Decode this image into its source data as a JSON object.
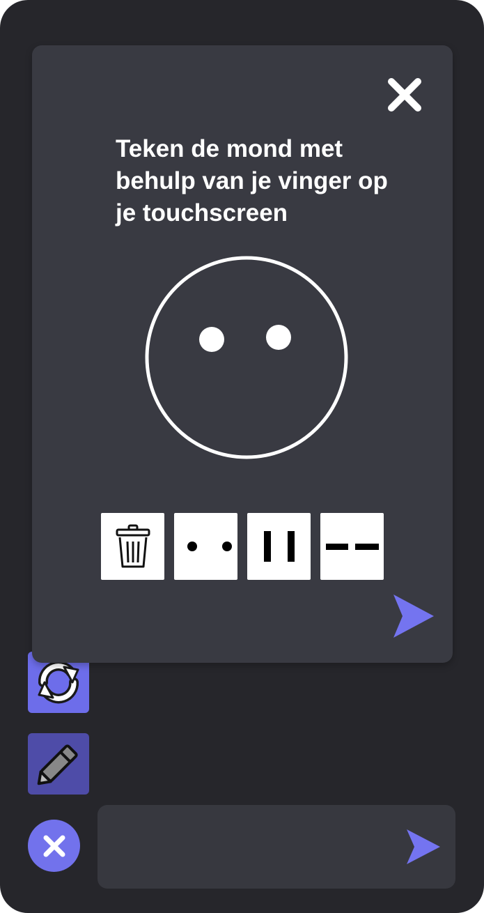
{
  "modal": {
    "instruction": "Teken de mond met behulp van je vinger op je touchscreen",
    "close_icon": "close-icon",
    "face_icon": "face-outline-icon",
    "mouth_options": [
      {
        "name": "delete-drawing-button",
        "icon": "trash-icon"
      },
      {
        "name": "mouth-option-dots",
        "icon": "dots-icon"
      },
      {
        "name": "mouth-option-vertical-bars",
        "icon": "vertical-bars-icon"
      },
      {
        "name": "mouth-option-dashes",
        "icon": "dashes-icon"
      }
    ],
    "send_icon": "send-icon"
  },
  "sidebar": {
    "buttons": [
      {
        "name": "refresh-button",
        "icon": "refresh-icon"
      },
      {
        "name": "draw-button",
        "icon": "pencil-icon"
      }
    ]
  },
  "chat": {
    "input_value": "",
    "close_icon": "close-icon",
    "send_icon": "send-icon"
  },
  "colors": {
    "background": "#26262b",
    "modal": "#393a42",
    "accent": "#7272ec",
    "accent_dark": "#4e4ca8",
    "input": "#37383f"
  }
}
